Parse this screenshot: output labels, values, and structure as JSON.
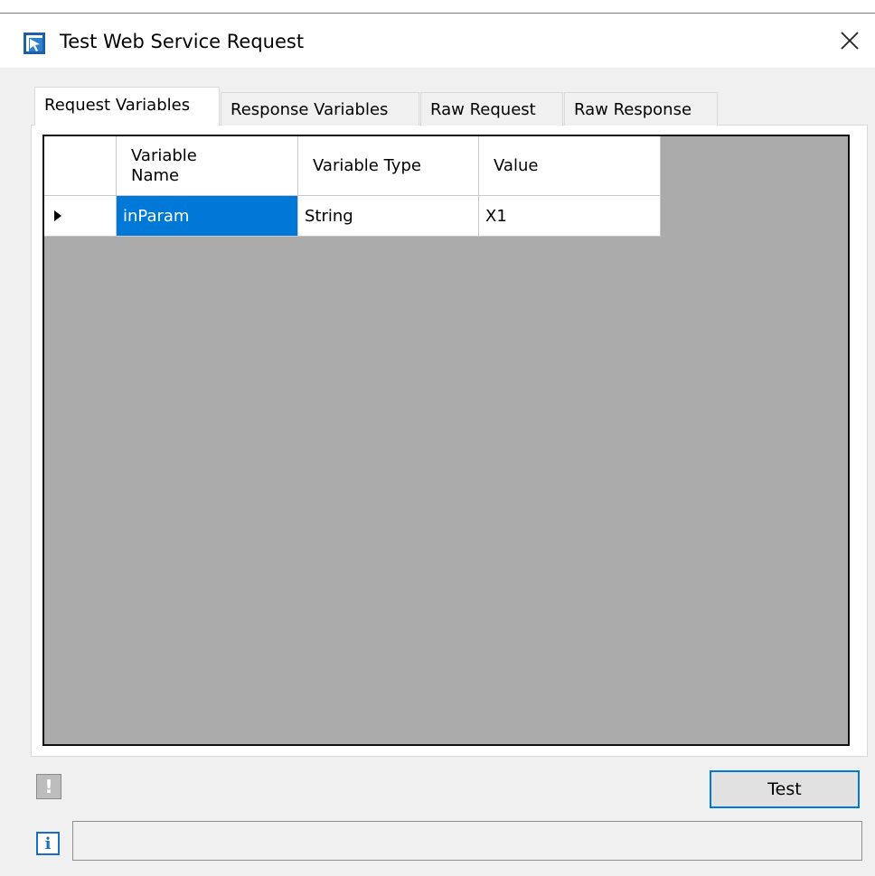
{
  "window": {
    "title": "Test Web Service Request"
  },
  "tabs": [
    {
      "label": "Request Variables",
      "active": true
    },
    {
      "label": "Response Variables",
      "active": false
    },
    {
      "label": "Raw Request",
      "active": false
    },
    {
      "label": "Raw Response",
      "active": false
    }
  ],
  "grid": {
    "columns": [
      "Variable\nName",
      "Variable Type",
      "Value"
    ],
    "rows": [
      {
        "name": "inParam",
        "type": "String",
        "value": "X1",
        "selected": true
      }
    ]
  },
  "actions": {
    "test_label": "Test"
  },
  "status": {
    "message": ""
  },
  "colors": {
    "accent": "#0078d7",
    "grid_background": "#ababab",
    "window_background": "#f0f0f0"
  },
  "icons": {
    "app": "web-service-app-icon",
    "close": "close-icon",
    "warning": "exclamation-icon",
    "info": "info-icon",
    "row_marker": "triangle-right-icon"
  }
}
